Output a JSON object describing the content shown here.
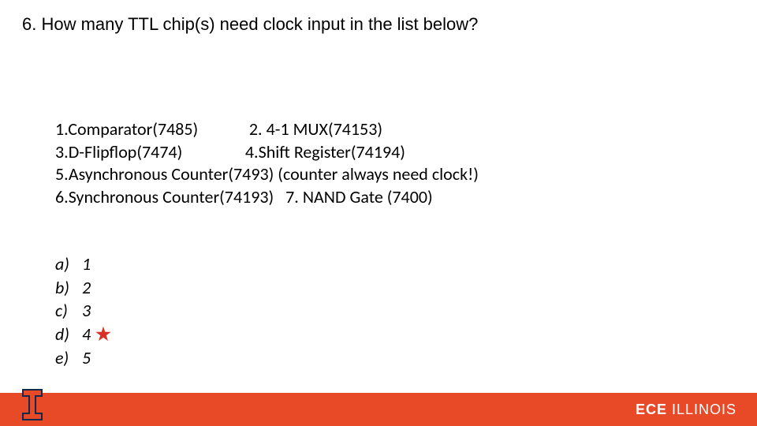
{
  "question": "6. How many TTL chip(s) need clock input in the list below?",
  "chips": {
    "row1_a": "1.Comparator(7485)",
    "row1_b": "2. 4-1 MUX(74153)",
    "row2_a": "3.D-Flipflop(7474)",
    "row2_b": "4.Shift Register(74194)",
    "row3": "5.Asynchronous Counter(7493) (counter always need clock!)",
    "row4_a": "6.Synchronous Counter(74193)",
    "row4_b": "7. NAND Gate (7400)"
  },
  "options": [
    {
      "letter": "a)",
      "value": "1",
      "correct": false
    },
    {
      "letter": "b)",
      "value": "2",
      "correct": false
    },
    {
      "letter": "c)",
      "value": "3",
      "correct": false
    },
    {
      "letter": "d)",
      "value": "4",
      "correct": true
    },
    {
      "letter": "e)",
      "value": "5",
      "correct": false
    }
  ],
  "star_glyph": "★",
  "footer": {
    "ece": "ECE",
    "illinois": " ILLINOIS"
  },
  "colors": {
    "illinois_orange": "#e84a27",
    "illinois_blue": "#13294b",
    "star_red": "#d93025"
  }
}
